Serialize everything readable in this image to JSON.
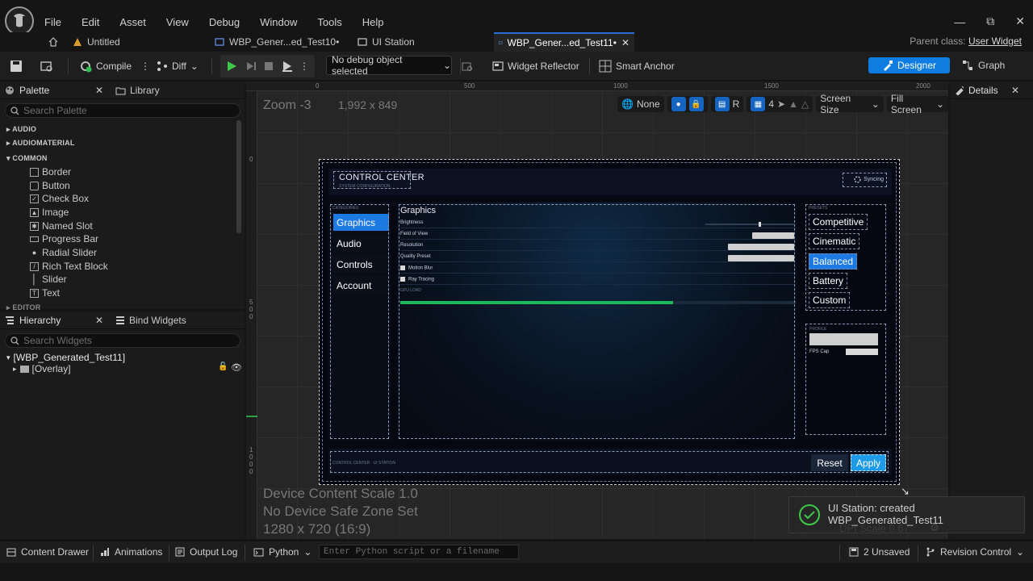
{
  "menu": [
    "File",
    "Edit",
    "Asset",
    "View",
    "Debug",
    "Window",
    "Tools",
    "Help"
  ],
  "tabs": [
    {
      "label": "Untitled"
    },
    {
      "label": "WBP_Gener...ed_Test10•"
    },
    {
      "label": "UI Station"
    },
    {
      "label": "WBP_Gener...ed_Test11•"
    }
  ],
  "parent_class": {
    "label": "Parent class:",
    "value": "User Widget"
  },
  "toolbar": {
    "compile": "Compile",
    "diff": "Diff",
    "debug_object": "No debug object selected",
    "widget_reflector": "Widget Reflector",
    "smart_anchor": "Smart Anchor",
    "designer": "Designer",
    "graph": "Graph"
  },
  "palette": {
    "tab": "Palette",
    "library": "Library",
    "search_placeholder": "Search Palette",
    "categories": [
      "AUDIO",
      "AUDIOMATERIAL",
      "COMMON",
      "EDITOR"
    ],
    "items": [
      "Border",
      "Button",
      "Check Box",
      "Image",
      "Named Slot",
      "Progress Bar",
      "Radial Slider",
      "Rich Text Block",
      "Slider",
      "Text"
    ]
  },
  "hierarchy": {
    "tab": "Hierarchy",
    "bind": "Bind Widgets",
    "search_placeholder": "Search Widgets",
    "root": "[WBP_Generated_Test11]",
    "child": "[Overlay]"
  },
  "canvas": {
    "zoom": "Zoom -3",
    "resolution": "1,992 x 849",
    "ruler_top": [
      "0",
      "500",
      "1000",
      "1500",
      "2000"
    ],
    "ruler_left_a": "0",
    "ruler_left_b": [
      "5",
      "0",
      "0"
    ],
    "ruler_left_c": [
      "1",
      "0",
      "0",
      "0"
    ],
    "none": "None",
    "r": "R",
    "grid_num": "4",
    "screen_size": "Screen Size",
    "fill_screen": "Fill Screen",
    "device_scale": "Device Content Scale 1.0",
    "safe_zone": "No Device Safe Zone Set",
    "device_res": "1280 x 720 (16:9)"
  },
  "widget": {
    "title": "CONTROL CENTER",
    "subtitle": "SYSTEM CONFIGURATION",
    "syncing": "Syncing",
    "categories_label": "CATEGORIES",
    "nav": [
      "Graphics",
      "Audio",
      "Controls",
      "Account"
    ],
    "section_title": "Graphics",
    "rows": [
      "Brightness",
      "Field of View",
      "Resolution",
      "Quality Preset",
      "Motion Blur",
      "Ray Tracing"
    ],
    "gpu_label": "GPU LOAD",
    "gpu_load": 0.69,
    "presets_label": "PRESETS",
    "presets": [
      "Competitive",
      "Cinematic",
      "Balanced",
      "Battery",
      "Custom"
    ],
    "profile_label": "PROFILE",
    "fps_label": "FPS Cap",
    "footer": "CONTROL CENTER · UI STATION",
    "reset": "Reset",
    "apply": "Apply"
  },
  "details": {
    "tab": "Details"
  },
  "toast": {
    "line1": "UI Station: created",
    "line2": "WBP_Generated_Test11",
    "behind": "DPI Scale 0.67"
  },
  "status": {
    "content_drawer": "Content Drawer",
    "animations": "Animations",
    "output_log": "Output Log",
    "python": "Python",
    "python_placeholder": "Enter Python script or a filename",
    "unsaved": "2 Unsaved",
    "revision": "Revision Control"
  },
  "colors": {
    "accent": "#0e7ce0",
    "widget_select": "#1e7ae3",
    "gpu": "#1eb85a"
  }
}
